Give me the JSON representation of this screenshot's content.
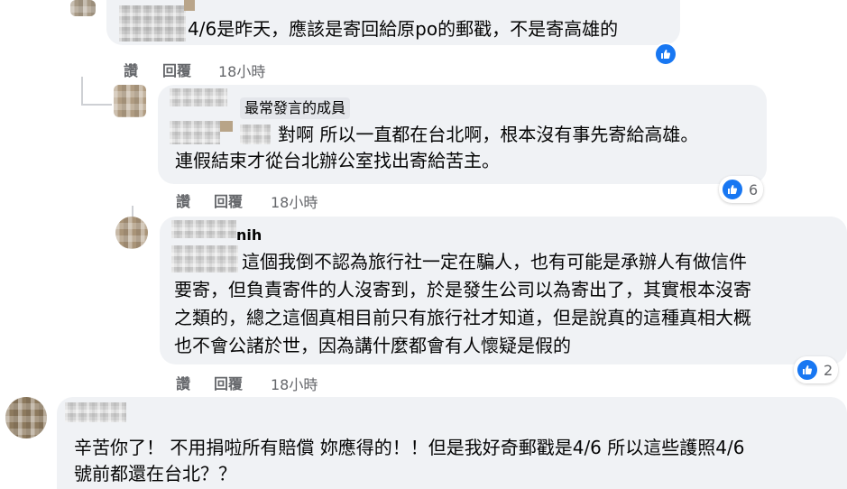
{
  "comments": [
    {
      "author_fragment": "",
      "lines": [
        "4/6是昨天，應該是寄回給原po的郵戳，不是寄高雄的"
      ],
      "actions": {
        "like": "讚",
        "reply": "回覆",
        "time": "18小時"
      },
      "reactions": {
        "icon": "like-icon",
        "count": ""
      }
    },
    {
      "badge": "最常發言的成員",
      "lines": [
        "對啊 所以一直都在台北啊，根本沒有事先寄給高雄。",
        "連假結束才從台北辦公室找出寄給苦主。"
      ],
      "actions": {
        "like": "讚",
        "reply": "回覆",
        "time": "18小時"
      },
      "reactions": {
        "icon": "like-icon",
        "count": "6"
      }
    },
    {
      "author_fragment": "nih",
      "lines": [
        "這個我倒不認為旅行社一定在騙人，也有可能是承辦人有做信件",
        "要寄，但負責寄件的人沒寄到，於是發生公司以為寄出了，其實根本沒寄",
        "之類的，總之這個真相目前只有旅行社才知道，但是說真的這種真相大概",
        "也不會公諸於世，因為講什麼都會有人懷疑是假的"
      ],
      "actions": {
        "like": "讚",
        "reply": "回覆",
        "time": "18小時"
      },
      "reactions": {
        "icon": "like-icon",
        "count": "2"
      }
    },
    {
      "lines": [
        "辛苦你了！ 不用捐啦所有賠償 妳應得的！！但是我好奇郵戳是4/6 所以這些護照4/6",
        "號前都還在台北？？"
      ]
    }
  ],
  "colors": {
    "bubble": "#f0f2f5",
    "like_blue": "#1877f2",
    "muted": "#65676b"
  }
}
